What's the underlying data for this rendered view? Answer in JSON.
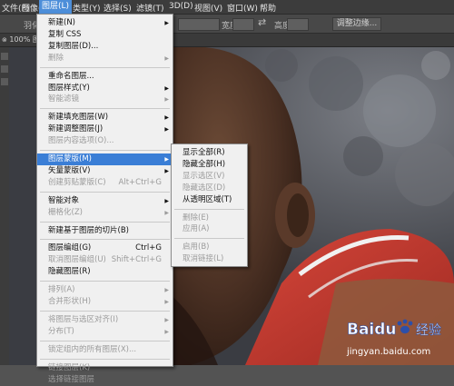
{
  "menubar": {
    "items": [
      "文件(F)",
      "图像(I)",
      "图层(L)",
      "类型(Y)",
      "选择(S)",
      "滤镜(T)",
      "3D(D)",
      "视图(V)",
      "窗口(W)",
      "帮助"
    ]
  },
  "options": {
    "left_text": "羽化",
    "width_label": "宽度：",
    "height_label": "高度：",
    "refine_button": "调整边缘..."
  },
  "tab": {
    "label": "100% 图层(L)"
  },
  "layer_menu": {
    "items": [
      {
        "label": "新建(N)",
        "sub": true
      },
      {
        "label": "复制 CSS"
      },
      {
        "label": "复制图层(D)..."
      },
      {
        "label": "删除",
        "sub": true,
        "disabled": true
      },
      {
        "sep": true
      },
      {
        "label": "重命名图层..."
      },
      {
        "label": "图层样式(Y)",
        "sub": true
      },
      {
        "label": "智能滤镜",
        "sub": true,
        "disabled": true
      },
      {
        "sep": true
      },
      {
        "label": "新建填充图层(W)",
        "sub": true
      },
      {
        "label": "新建调整图层(J)",
        "sub": true
      },
      {
        "label": "图层内容选项(O)...",
        "disabled": true
      },
      {
        "sep": true
      },
      {
        "label": "图层蒙版(M)",
        "sub": true,
        "highlighted": true
      },
      {
        "label": "矢量蒙版(V)",
        "sub": true
      },
      {
        "label": "创建剪贴蒙版(C)",
        "shortcut": "Alt+Ctrl+G",
        "disabled": true
      },
      {
        "sep": true
      },
      {
        "label": "智能对象",
        "sub": true
      },
      {
        "label": "栅格化(Z)",
        "sub": true,
        "disabled": true
      },
      {
        "sep": true
      },
      {
        "label": "新建基于图层的切片(B)"
      },
      {
        "sep": true
      },
      {
        "label": "图层编组(G)",
        "shortcut": "Ctrl+G"
      },
      {
        "label": "取消图层编组(U)",
        "shortcut": "Shift+Ctrl+G",
        "disabled": true
      },
      {
        "label": "隐藏图层(R)"
      },
      {
        "sep": true
      },
      {
        "label": "排列(A)",
        "sub": true,
        "disabled": true
      },
      {
        "label": "合并形状(H)",
        "sub": true,
        "disabled": true
      },
      {
        "sep": true
      },
      {
        "label": "将图层与选区对齐(I)",
        "sub": true,
        "disabled": true
      },
      {
        "label": "分布(T)",
        "sub": true,
        "disabled": true
      },
      {
        "sep": true
      },
      {
        "label": "锁定组内的所有图层(X)...",
        "disabled": true
      },
      {
        "sep": true
      },
      {
        "label": "链接图层(K)",
        "disabled": true
      },
      {
        "label": "选择链接图层",
        "disabled": true
      }
    ]
  },
  "mask_submenu": {
    "items": [
      {
        "label": "显示全部(R)"
      },
      {
        "label": "隐藏全部(H)"
      },
      {
        "label": "显示选区(V)",
        "disabled": true
      },
      {
        "label": "隐藏选区(D)",
        "disabled": true
      },
      {
        "label": "从透明区域(T)"
      },
      {
        "sep": true
      },
      {
        "label": "删除(E)",
        "disabled": true
      },
      {
        "label": "应用(A)",
        "disabled": true
      },
      {
        "sep": true
      },
      {
        "label": "启用(B)",
        "disabled": true
      },
      {
        "label": "取消链接(L)",
        "disabled": true
      }
    ]
  },
  "watermark": {
    "brand": "Baidu",
    "brand2": "经验",
    "url": "jingyan.baidu.com"
  },
  "colors": {
    "menubar": "#3c3c3c",
    "highlight": "#3a7ed6",
    "menu_bg": "#f0f0f0",
    "jersey": "#c63a2e"
  }
}
